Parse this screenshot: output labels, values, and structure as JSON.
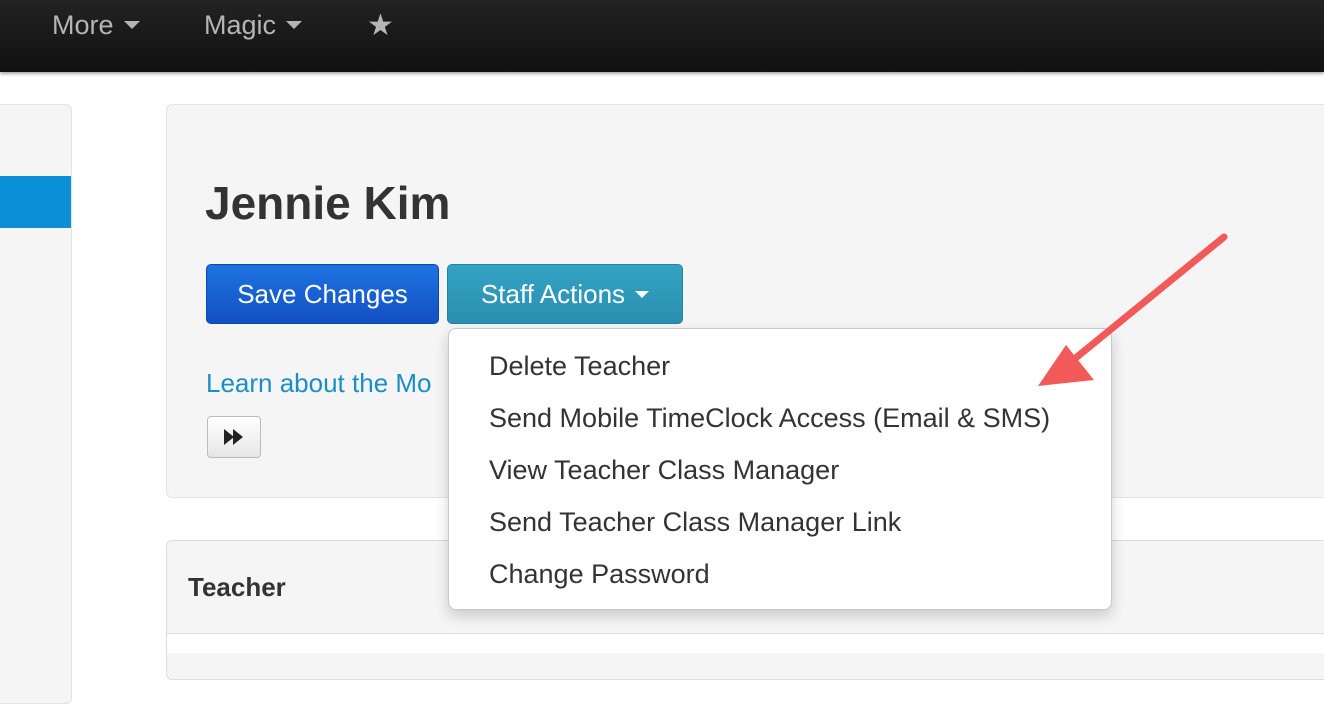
{
  "navbar": {
    "items": [
      {
        "label": "More",
        "icon": "caret-down-icon"
      },
      {
        "label": "Magic",
        "icon": "caret-down-icon"
      },
      {
        "label": "★",
        "icon": "star-icon"
      }
    ]
  },
  "header": {
    "title": "Jennie Kim"
  },
  "actions": {
    "save_label": "Save Changes",
    "staff_label": "Staff Actions"
  },
  "learn_link": "Learn about the Mo",
  "staff_menu": {
    "items": [
      "Delete Teacher",
      "Send Mobile TimeClock Access (Email & SMS)",
      "View Teacher Class Manager",
      "Send Teacher Class Manager Link",
      "Change Password"
    ]
  },
  "teacher_section": {
    "heading": "Teacher"
  },
  "colors": {
    "navbar": "#1a1a1a",
    "primary_button": "#1a63d6",
    "staff_button": "#309bbd",
    "link": "#1a8fc5",
    "sidebar_active": "#0b8fd6",
    "annotation_arrow": "#f25a5a"
  }
}
